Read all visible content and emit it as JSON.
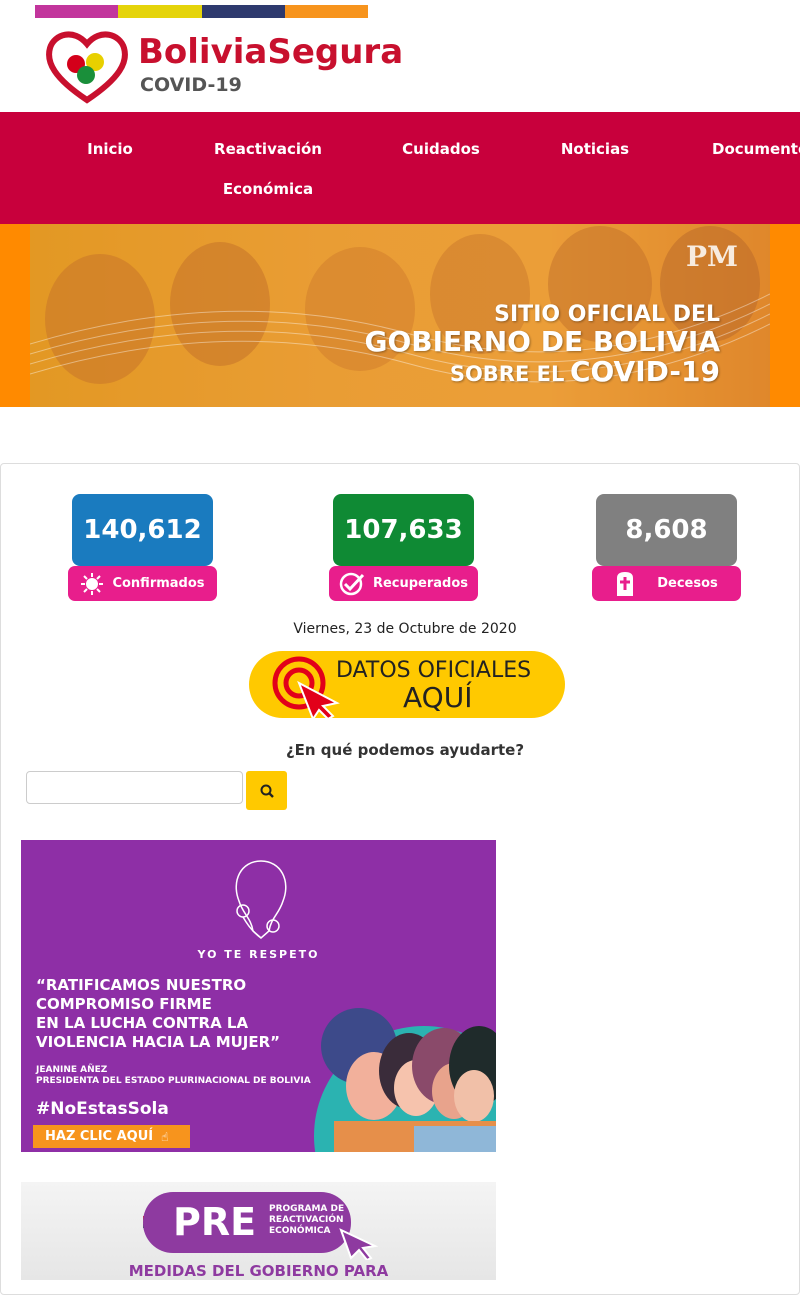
{
  "header": {
    "logo_title": "BoliviaSegura",
    "logo_subtitle": "COVID-19",
    "colorbar": [
      "#c2359c",
      "#e5d40a",
      "#2e3a6e",
      "#f7941d"
    ]
  },
  "nav": {
    "items": [
      {
        "label": "Inicio"
      },
      {
        "label": "Reactivación"
      },
      {
        "label": "Económica"
      },
      {
        "label": "Cuidados"
      },
      {
        "label": "Noticias"
      },
      {
        "label": "Documentos"
      }
    ]
  },
  "banner": {
    "line1": "SITIO OFICIAL DEL",
    "line2": "GOBIERNO DE BOLIVIA",
    "line3a": "SOBRE EL",
    "line3b": "COVID-19",
    "badge": "PM"
  },
  "stats": [
    {
      "value": "140,612",
      "label": "Confirmados",
      "color": "#1a7bbf",
      "icon": "virus-icon"
    },
    {
      "value": "107,633",
      "label": "Recuperados",
      "color": "#0f8a34",
      "icon": "check-icon"
    },
    {
      "value": "8,608",
      "label": "Decesos",
      "color": "#808080",
      "icon": "cross-icon"
    }
  ],
  "date_text": "Viernes, 23 de Octubre de 2020",
  "datos_button": {
    "line1": "DATOS OFICIALES",
    "line2": "AQUÍ"
  },
  "search": {
    "prompt": "¿En qué podemos ayudarte?",
    "placeholder": ""
  },
  "promo1": {
    "tag": "YO TE RESPETO",
    "quote": [
      "“RATIFICAMOS NUESTRO",
      "COMPROMISO FIRME",
      "EN LA LUCHA CONTRA LA",
      "VIOLENCIA HACIA LA MUJER”"
    ],
    "author": "JEANINE AÑEZ",
    "author_role": "PRESIDENTA DEL ESTADO PLURINACIONAL DE BOLIVIA",
    "hashtag": "#NoEstasSola",
    "cta": "HAZ CLIC AQUÍ"
  },
  "promo2": {
    "pre": "PRE",
    "pre_desc": [
      "PROGRAMA DE",
      "REACTIVACIÓN",
      "ECONÓMICA"
    ],
    "headline": "MEDIDAS DEL GOBIERNO PARA"
  }
}
